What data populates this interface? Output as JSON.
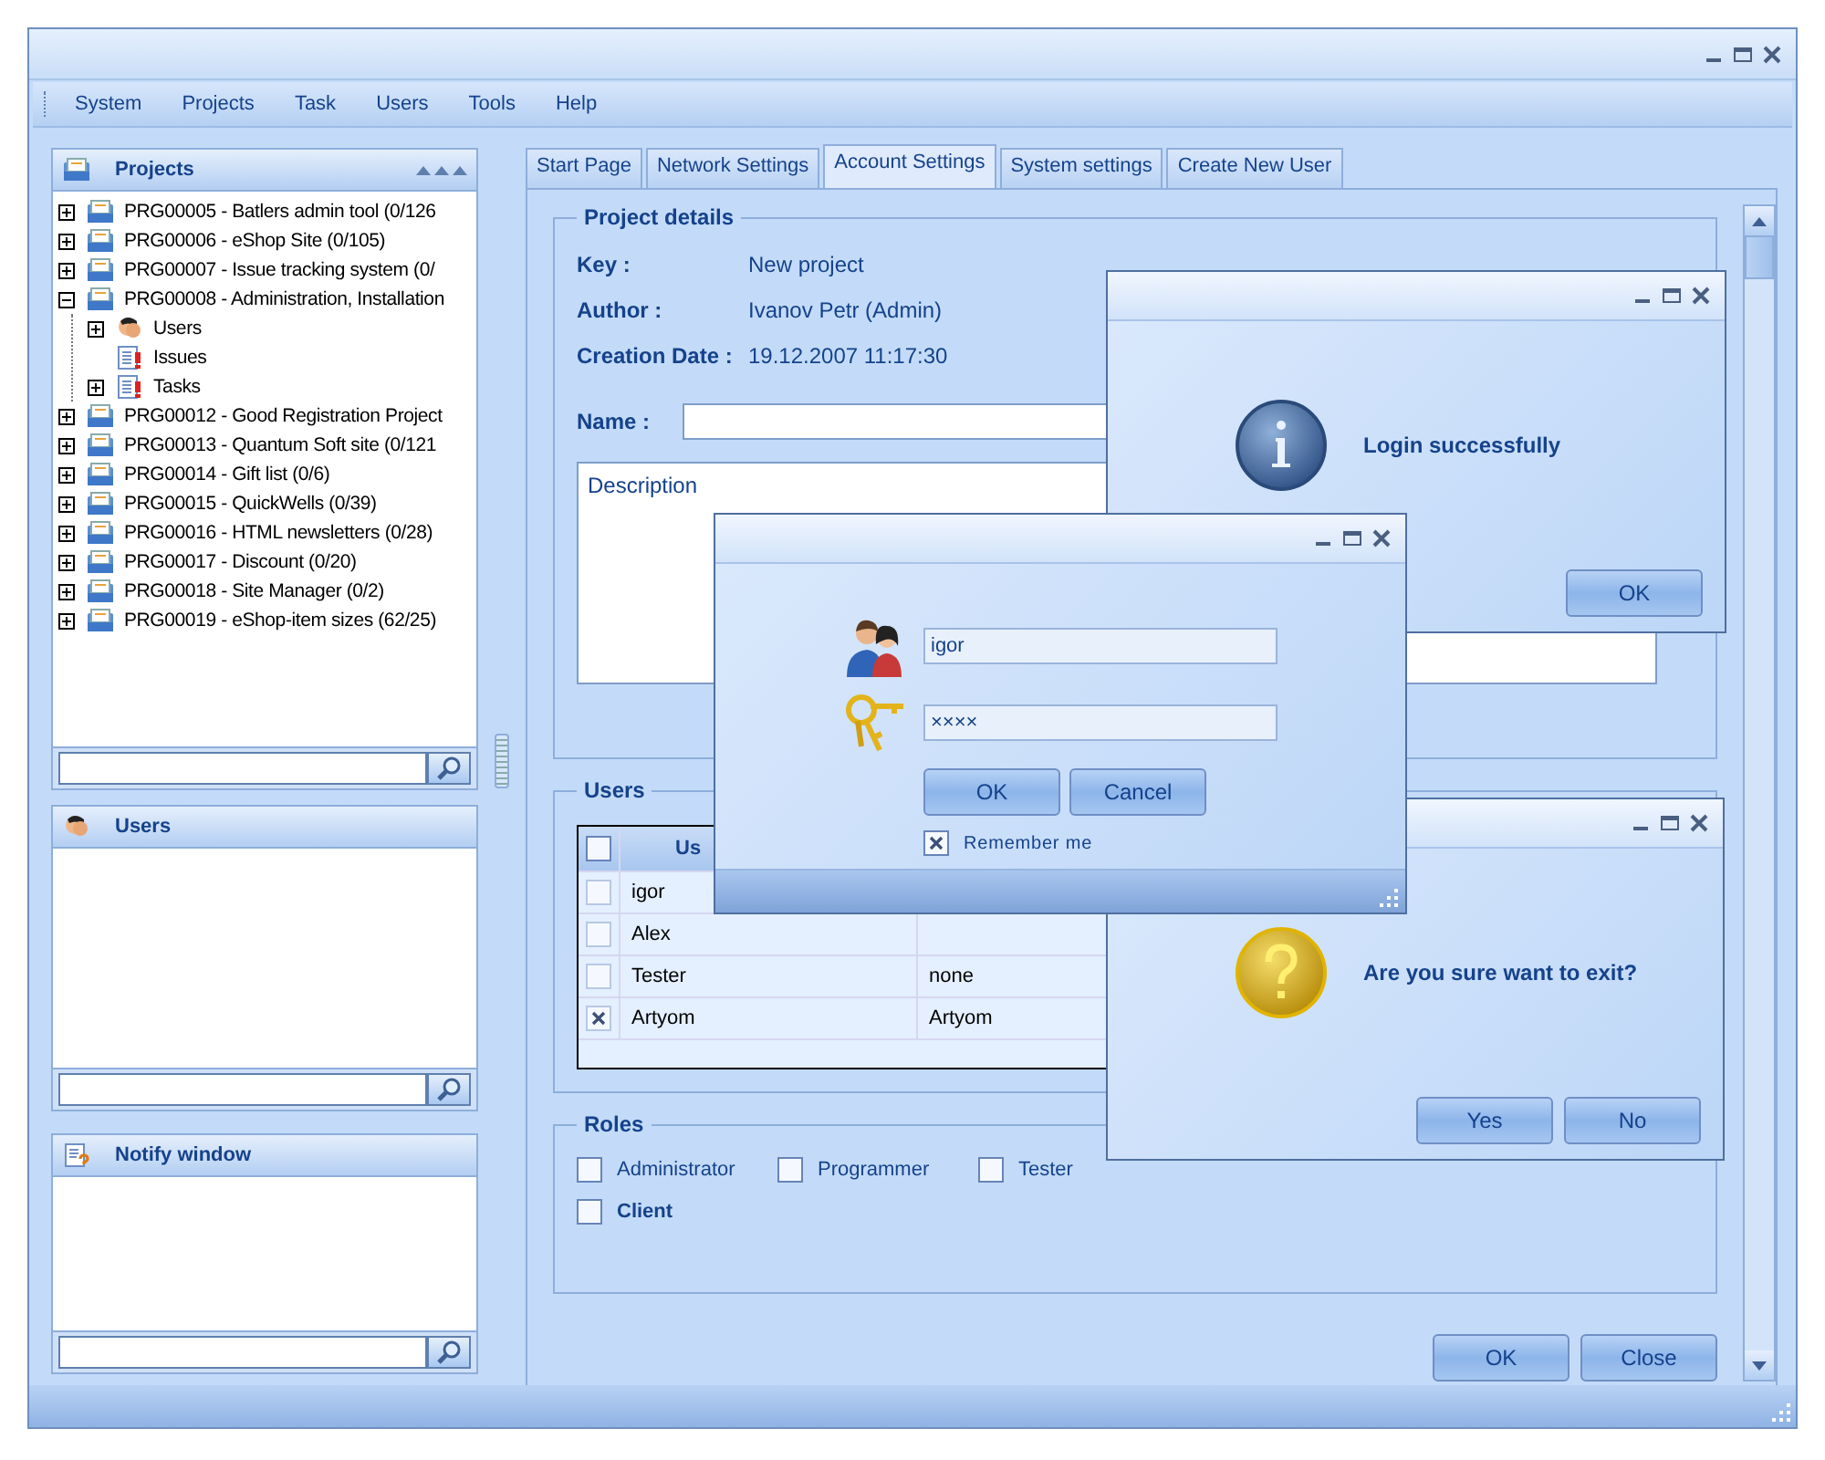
{
  "menu": [
    "System",
    "Projects",
    "Task",
    "Users",
    "Tools",
    "Help"
  ],
  "sidebar": {
    "panels": [
      {
        "kind": "tree",
        "title": "Projects",
        "items": [
          {
            "kind": "project",
            "label": "PRG00005 - Batlers admin tool  (0/126",
            "expanded": false
          },
          {
            "kind": "project",
            "label": "PRG00006 - eShop Site  (0/105)",
            "expanded": false
          },
          {
            "kind": "project",
            "label": "PRG00007 - Issue tracking system  (0/",
            "expanded": false
          },
          {
            "kind": "project",
            "label": "PRG00008 - Administration, Installation",
            "expanded": true,
            "children": [
              {
                "kind": "users",
                "label": "Users",
                "expanded": false
              },
              {
                "kind": "issues",
                "label": "Issues"
              },
              {
                "kind": "issues",
                "label": "Tasks",
                "expanded": false
              }
            ]
          },
          {
            "kind": "project",
            "label": "PRG00012 - Good Registration Project",
            "expanded": false
          },
          {
            "kind": "project",
            "label": "PRG00013 - Quantum Soft site  (0/121",
            "expanded": false
          },
          {
            "kind": "project",
            "label": "PRG00014 - Gift list  (0/6)",
            "expanded": false
          },
          {
            "kind": "project",
            "label": "PRG00015 - QuickWells  (0/39)",
            "expanded": false
          },
          {
            "kind": "project",
            "label": "PRG00016 - HTML newsletters  (0/28)",
            "expanded": false
          },
          {
            "kind": "project",
            "label": "PRG00017 - Discount  (0/20)",
            "expanded": false
          },
          {
            "kind": "project",
            "label": "PRG00018 - Site Manager  (0/2)",
            "expanded": false
          },
          {
            "kind": "project",
            "label": "PRG00019 - eShop-item sizes  (62/25)",
            "expanded": false
          }
        ]
      },
      {
        "kind": "users",
        "title": "Users"
      },
      {
        "kind": "notify",
        "title": "Notify window"
      }
    ]
  },
  "tabs": [
    {
      "label": "Start Page",
      "selected": false
    },
    {
      "label": "Network Settings",
      "selected": false
    },
    {
      "label": "Account Settings",
      "selected": true
    },
    {
      "label": "System settings",
      "selected": false
    },
    {
      "label": "Create New User",
      "selected": false
    }
  ],
  "project_details": {
    "title": "Project details",
    "fields": [
      {
        "label": "Key :",
        "value": "New project"
      },
      {
        "label": "Author :",
        "value": "Ivanov Petr (Admin)"
      },
      {
        "label": "Creation Date :",
        "value": "19.12.2007 11:17:30"
      }
    ],
    "name_label": "Name :",
    "description_placeholder": "Description"
  },
  "users": {
    "title": "Users",
    "header_checked": false,
    "columns": [
      "Us"
    ],
    "rows": [
      {
        "checked": false,
        "cells": [
          "igor"
        ]
      },
      {
        "checked": false,
        "cells": [
          "Alex"
        ]
      },
      {
        "checked": false,
        "cells": [
          "Tester",
          "none"
        ]
      },
      {
        "checked": true,
        "cells": [
          "Artyom",
          "Artyom"
        ]
      }
    ]
  },
  "roles": {
    "title": "Roles",
    "rows": [
      [
        {
          "label": "Administrator",
          "checked": false
        },
        {
          "label": "Programmer",
          "checked": false
        },
        {
          "label": "Tester",
          "checked": false
        }
      ],
      [
        {
          "label": "Client",
          "checked": false,
          "focused": true
        }
      ]
    ]
  },
  "buttons": [
    "OK",
    "Close"
  ],
  "dialogs": [
    {
      "kind": "info",
      "message": "Login successfully",
      "buttons": [
        "OK"
      ]
    },
    {
      "kind": "question",
      "message": "Are you sure want to exit?",
      "buttons": [
        "Yes",
        "No"
      ]
    },
    {
      "kind": "login",
      "username": "igor",
      "password": "××××",
      "remember_label": "Remember me",
      "remember_checked": true,
      "buttons": [
        "OK",
        "Cancel"
      ]
    }
  ]
}
